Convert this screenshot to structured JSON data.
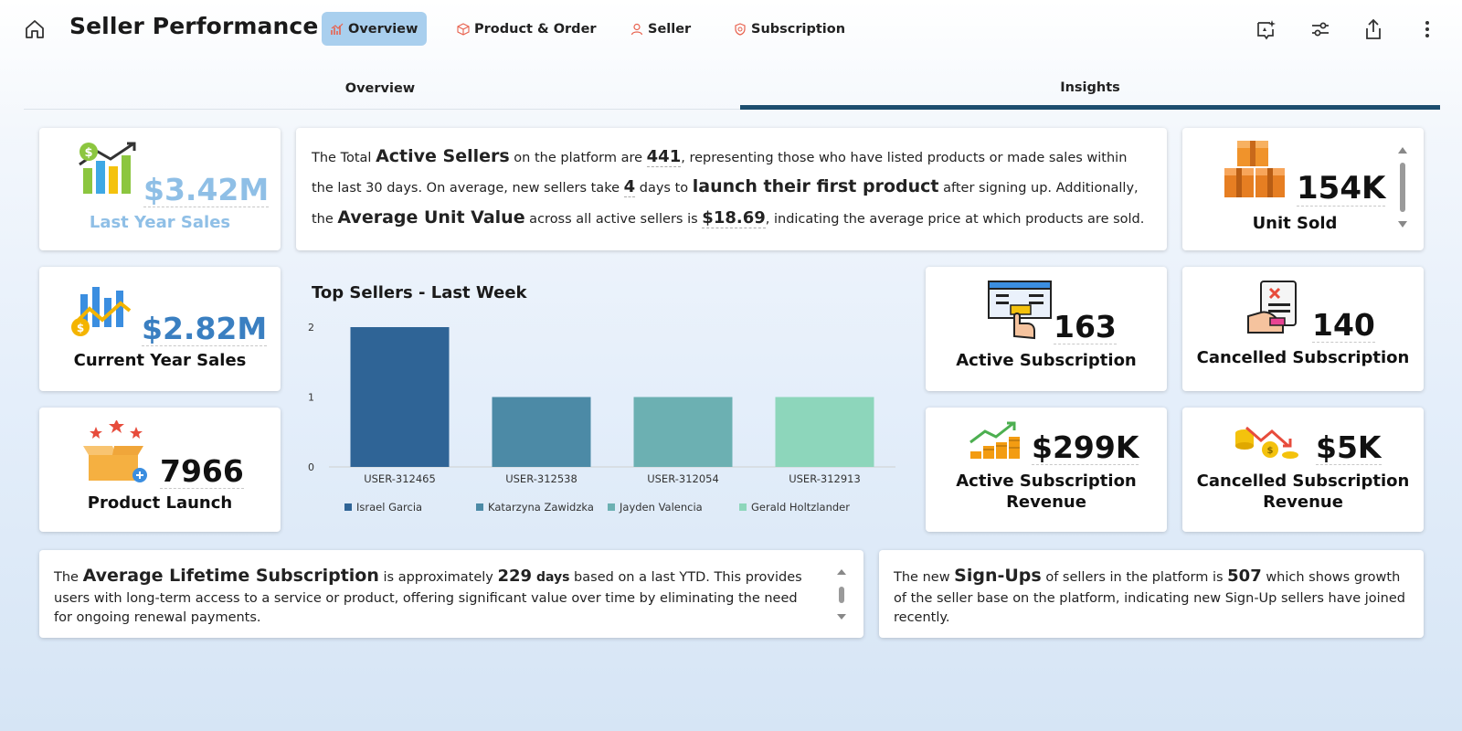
{
  "header": {
    "title": "Seller Performance",
    "tabs": [
      {
        "label": "Overview",
        "active": true
      },
      {
        "label": "Product & Order",
        "active": false
      },
      {
        "label": "Seller",
        "active": false
      },
      {
        "label": "Subscription",
        "active": false
      }
    ],
    "tools": [
      "smart-narrative-icon",
      "filter-sliders-icon",
      "share-icon",
      "more-options-icon"
    ]
  },
  "subtabs": [
    {
      "label": "Overview",
      "active": false
    },
    {
      "label": "Insights",
      "active": true
    }
  ],
  "kpis": {
    "last_year_sales": {
      "value": "$3.42M",
      "label": "Last Year Sales"
    },
    "current_year_sales": {
      "value": "$2.82M",
      "label": "Current Year Sales"
    },
    "product_launch": {
      "value": "7966",
      "label": "Product Launch"
    },
    "unit_sold": {
      "value": "154K",
      "label": "Unit Sold"
    },
    "active_subscription": {
      "value": "163",
      "label": "Active Subscription"
    },
    "cancelled_subscription": {
      "value": "140",
      "label": "Cancelled Subscription"
    },
    "active_sub_revenue": {
      "value": "$299K",
      "label1": "Active Subscription",
      "label2": "Revenue"
    },
    "cancelled_sub_revenue": {
      "value": "$5K",
      "label1": "Cancelled Subscription",
      "label2": "Revenue"
    }
  },
  "insight_top": {
    "t1": "The Total ",
    "b1": "Active Sellers",
    "t2": " on the platform are ",
    "n1": "441",
    "t3": ", representing those who have listed products or made sales within the last 30 days. On average, new sellers take ",
    "n2": "4",
    "t4": " days to ",
    "b2": "launch their first product",
    "t5": " after signing up. Additionally, the ",
    "b3": "Average Unit Value",
    "t6": " across all active sellers is ",
    "n3": "$18.69",
    "t7": ", indicating the average price at which products are sold."
  },
  "insight_lifetime": {
    "t1": "The ",
    "b1": "Average Lifetime Subscription",
    "t2": " is approximately ",
    "n1": "229",
    "b2": " days",
    "t3": " based on a last YTD. This provides users with long-term access to a service or product, offering significant value over time by eliminating the need for ongoing renewal payments."
  },
  "insight_signups": {
    "t1": "The new ",
    "b1": "Sign-Ups",
    "t2": " of sellers in the platform is ",
    "n1": "507",
    "t3": " which shows growth of the seller base on the platform, indicating new Sign-Up sellers have joined recently."
  },
  "chart_data": {
    "type": "bar",
    "title": "Top Sellers - Last Week",
    "categories": [
      "USER-312465",
      "USER-312538",
      "USER-312054",
      "USER-312913"
    ],
    "values": [
      2,
      1,
      1,
      1
    ],
    "ylim": [
      0,
      2
    ],
    "yticks": [
      "0",
      "1",
      "2"
    ],
    "colors": [
      "#2f6496",
      "#4c8aa6",
      "#6cb0b2",
      "#8dd6bb"
    ],
    "legend": [
      "Israel Garcia",
      "Katarzyna Zawidzka",
      "Jayden Valencia",
      "Gerald Holtzlander"
    ],
    "legend_position": "bottom"
  }
}
